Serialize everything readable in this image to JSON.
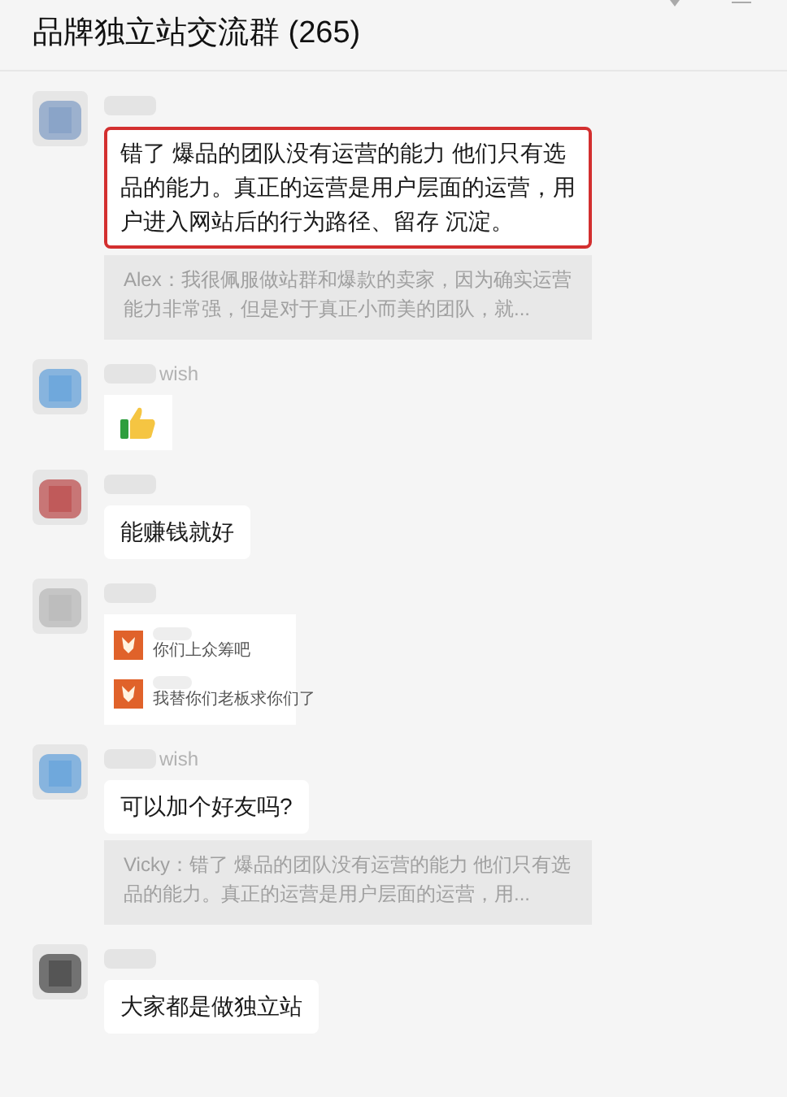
{
  "window": {
    "title": "品牌独立站交流群 (265)"
  },
  "messages": [
    {
      "color": "#8aa4c8",
      "kind": "text",
      "text": "错了 爆品的团队没有运营的能力 他们只有选品的能力。真正的运营是用户层面的运营，用户进入网站后的行为路径、留存 沉淀。",
      "highlighted": true,
      "quote": "Alex：我很佩服做站群和爆款的卖家，因为确实运营能力非常强，但是对于真正小而美的团队，就..."
    },
    {
      "color": "#6fa8dc",
      "sender": "wish",
      "kind": "emoji",
      "highlighted": false
    },
    {
      "color": "#c05a5a",
      "kind": "text",
      "text": "能赚钱就好",
      "highlighted": false
    },
    {
      "color": "#bdbdbd",
      "kind": "forward",
      "items": [
        "你们上众筹吧",
        "我替你们老板求你们了"
      ],
      "highlighted": false
    },
    {
      "color": "#6fa8dc",
      "sender": "wish",
      "kind": "text",
      "text": "可以加个好友吗?",
      "highlighted": false,
      "quote": "Vicky：错了 爆品的团队没有运营的能力 他们只有选品的能力。真正的运营是用户层面的运营，用..."
    },
    {
      "color": "#555555",
      "kind": "text",
      "text": "大家都是做独立站",
      "highlighted": false
    }
  ]
}
